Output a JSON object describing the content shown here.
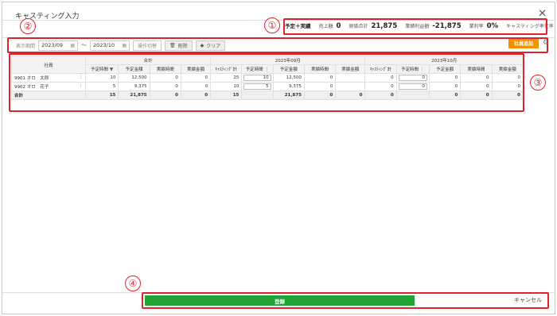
{
  "window": {
    "title": "キャスティング入力",
    "close": "✕"
  },
  "callouts": [
    "①",
    "②",
    "③",
    "④"
  ],
  "summary": {
    "mode": "予定＋実績",
    "items": [
      {
        "label": "売上額",
        "value": "0"
      },
      {
        "label": "原価合計",
        "value": "21,875"
      },
      {
        "label": "業績利益額",
        "value": "-21,875"
      },
      {
        "label": "業利率",
        "value": "0%"
      },
      {
        "label": "キャスティング率化率",
        "value": "0%"
      }
    ]
  },
  "toolbar": {
    "period_label": "表示期間",
    "from": "2023/09",
    "tilde": "～",
    "to": "2023/10",
    "ops_label": "操作切替",
    "delete_label": "削除",
    "clear_label": "クリア",
    "add_label": "社員追加",
    "calendar_icon": "calendar-icon",
    "trash_icon": "trash-icon",
    "eraser_icon": "eraser-icon",
    "gear_icon": "gear-icon"
  },
  "table": {
    "employee_header": "社員",
    "groups": [
      "合計",
      "2023年09月",
      "2023年10月"
    ],
    "total_cols": [
      "予定時間",
      "予定金額",
      "実績時間",
      "実績金額"
    ],
    "month_cols": [
      "ｷｬｽﾃｨﾝｸﾞ計",
      "予定時間",
      "予定金額",
      "実績時間",
      "実績金額"
    ],
    "rows": [
      {
        "id": "9901",
        "name": "オロ　太郎",
        "total": [
          "10",
          "12,500",
          "0",
          "0"
        ],
        "m1": [
          "25",
          "10",
          "12,500",
          "0",
          ""
        ],
        "m2": [
          "0",
          "0",
          "0",
          "0",
          "0"
        ]
      },
      {
        "id": "9902",
        "name": "オロ　花子",
        "total": [
          "5",
          "9,375",
          "0",
          "0"
        ],
        "m1": [
          "10",
          "5",
          "9,375",
          "0",
          ""
        ],
        "m2": [
          "0",
          "0",
          "0",
          "0",
          "0"
        ]
      }
    ],
    "total_row": {
      "label": "合計",
      "total": [
        "15",
        "21,875",
        "0",
        "0"
      ],
      "m1": [
        "15",
        "",
        "21,875",
        "0",
        "0"
      ],
      "m2": [
        "0",
        "",
        "0",
        "0",
        "0"
      ]
    }
  },
  "footer": {
    "register": "登録",
    "cancel": "キャンセル"
  }
}
